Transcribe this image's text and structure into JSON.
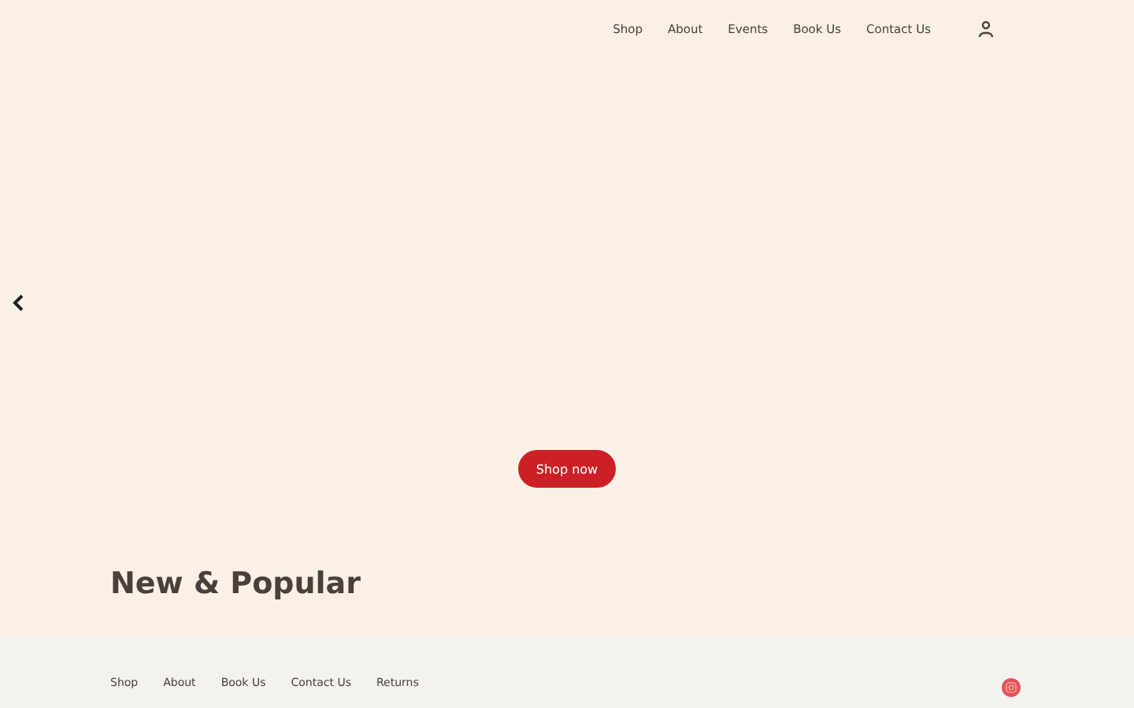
{
  "header": {
    "nav": [
      "Shop",
      "About",
      "Events",
      "Book Us",
      "Contact Us"
    ]
  },
  "hero": {
    "cta": "Shop now"
  },
  "section": {
    "title": "New & Popular"
  },
  "footer": {
    "links": [
      "Shop",
      "About",
      "Book Us",
      "Contact Us",
      "Returns"
    ]
  }
}
